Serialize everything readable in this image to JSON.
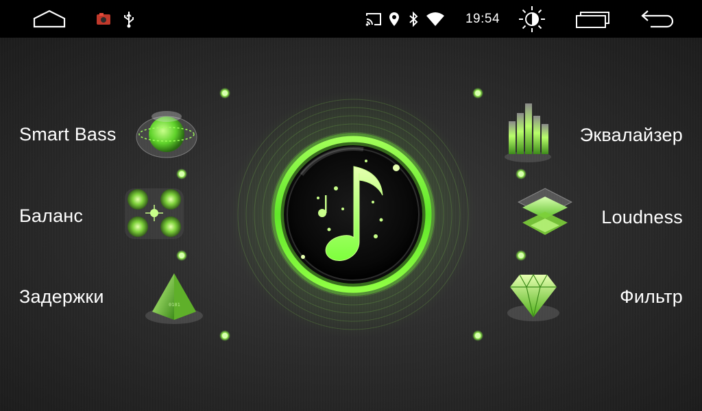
{
  "status_bar": {
    "time": "19:54",
    "icons": [
      "home-icon",
      "notification-app-icon",
      "usb-icon",
      "cast-icon",
      "location-icon",
      "bluetooth-icon",
      "wifi-icon",
      "brightness-icon",
      "recent-apps-icon",
      "back-icon"
    ]
  },
  "menu": {
    "left": [
      {
        "label": "Smart Bass",
        "icon": "sphere-icon"
      },
      {
        "label": "Баланс",
        "icon": "speakers-icon"
      },
      {
        "label": "Задержки",
        "icon": "pyramid-icon"
      }
    ],
    "right": [
      {
        "label": "Эквалайзер",
        "icon": "equalizer-bars-icon"
      },
      {
        "label": "Loudness",
        "icon": "layers-icon"
      },
      {
        "label": "Фильтр",
        "icon": "gem-icon"
      }
    ],
    "center_icon": "music-note-icon"
  },
  "colors": {
    "accent": "#7dff3c",
    "accent_light": "#c8ff8a",
    "line": "#6a6a6a",
    "background": "#2c2c2c"
  }
}
